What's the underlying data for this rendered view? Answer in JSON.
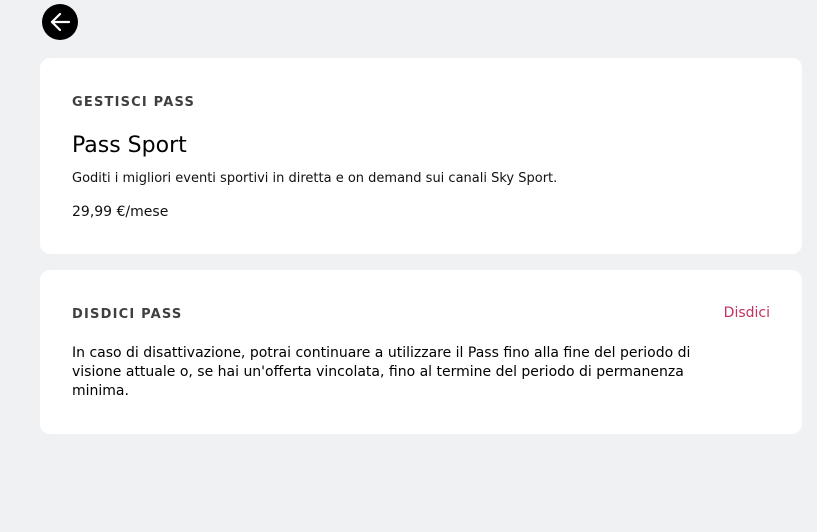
{
  "back": {
    "icon": "arrow-left-icon"
  },
  "manage": {
    "section_title": "GESTISCI PASS",
    "pass_name": "Pass Sport",
    "description": "Goditi i migliori eventi sportivi in diretta e on demand sui canali Sky Sport.",
    "price": "29,99 €/mese"
  },
  "cancel": {
    "section_title": "DISDICI PASS",
    "action_label": "Disdici",
    "text": "In caso di disattivazione, potrai continuare a utilizzare il Pass fino alla fine del periodo di visione attuale o, se hai un'offerta vincolata, fino al termine del periodo di permanenza minima."
  },
  "colors": {
    "background": "#f0f1f3",
    "card": "#ffffff",
    "accent": "#c4325e",
    "back_button": "#000000"
  }
}
